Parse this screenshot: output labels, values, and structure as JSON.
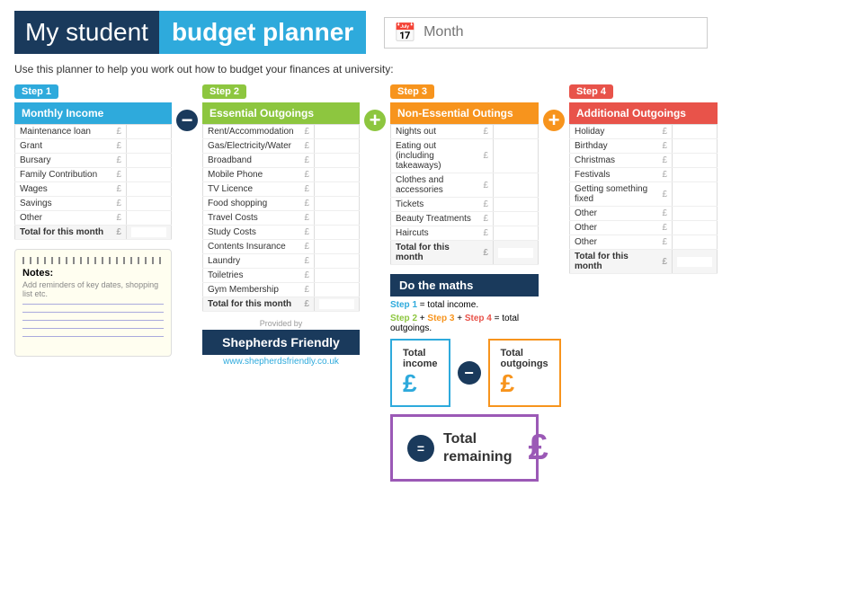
{
  "header": {
    "title_left": "My student",
    "title_right": "budget planner",
    "month_placeholder": "Month"
  },
  "subtitle": "Use this planner to help you work out how to budget your finances at university:",
  "steps": {
    "step1": {
      "label": "Step 1",
      "title": "Monthly Income",
      "rows": [
        {
          "label": "Maintenance loan",
          "currency": "£"
        },
        {
          "label": "Grant",
          "currency": "£"
        },
        {
          "label": "Bursary",
          "currency": "£"
        },
        {
          "label": "Family Contribution",
          "currency": "£"
        },
        {
          "label": "Wages",
          "currency": "£"
        },
        {
          "label": "Savings",
          "currency": "£"
        },
        {
          "label": "Other",
          "currency": "£"
        }
      ],
      "total_label": "Total for this month",
      "total_currency": "£"
    },
    "step2": {
      "label": "Step 2",
      "title": "Essential Outgoings",
      "rows": [
        {
          "label": "Rent/Accommodation",
          "currency": "£"
        },
        {
          "label": "Gas/Electricity/Water",
          "currency": "£"
        },
        {
          "label": "Broadband",
          "currency": "£"
        },
        {
          "label": "Mobile Phone",
          "currency": "£"
        },
        {
          "label": "TV Licence",
          "currency": "£"
        },
        {
          "label": "Food shopping",
          "currency": "£"
        },
        {
          "label": "Travel Costs",
          "currency": "£"
        },
        {
          "label": "Study Costs",
          "currency": "£"
        },
        {
          "label": "Contents Insurance",
          "currency": "£"
        },
        {
          "label": "Laundry",
          "currency": "£"
        },
        {
          "label": "Toiletries",
          "currency": "£"
        },
        {
          "label": "Gym Membership",
          "currency": "£"
        }
      ],
      "total_label": "Total for this month",
      "total_currency": "£"
    },
    "step3": {
      "label": "Step 3",
      "title": "Non-Essential Outings",
      "rows": [
        {
          "label": "Nights out",
          "currency": "£"
        },
        {
          "label": "Eating out (including takeaways)",
          "currency": "£"
        },
        {
          "label": "Clothes and accessories",
          "currency": "£"
        },
        {
          "label": "Tickets",
          "currency": "£"
        },
        {
          "label": "Beauty Treatments",
          "currency": "£"
        },
        {
          "label": "Haircuts",
          "currency": "£"
        }
      ],
      "total_label": "Total for this month",
      "total_currency": "£"
    },
    "step4": {
      "label": "Step 4",
      "title": "Additional Outgoings",
      "rows": [
        {
          "label": "Holiday",
          "currency": "£"
        },
        {
          "label": "Birthday",
          "currency": "£"
        },
        {
          "label": "Christmas",
          "currency": "£"
        },
        {
          "label": "Festivals",
          "currency": "£"
        },
        {
          "label": "Getting something fixed",
          "currency": "£"
        },
        {
          "label": "Other",
          "currency": "£"
        },
        {
          "label": "Other",
          "currency": "£"
        },
        {
          "label": "Other",
          "currency": "£"
        }
      ],
      "total_label": "Total for this month",
      "total_currency": "£"
    }
  },
  "notes": {
    "title": "Notes:",
    "subtitle": "Add reminders of key dates, shopping list etc."
  },
  "provided_by": "Provided by",
  "shepherds": {
    "name": "Shepherds Friendly",
    "url": "www.shepherdsfriendly.co.uk"
  },
  "do_maths": {
    "title": "Do the maths",
    "line1_prefix": "Step 1",
    "line1_text": " = total income.",
    "line2_step2": "Step 2",
    "line2_plus1": " + ",
    "line2_step3": "Step 3",
    "line2_plus2": " + ",
    "line2_step4": "Step 4",
    "line2_text": " = total outgoings.",
    "total_income_label": "Total\nincome",
    "total_income_pound": "£",
    "total_outgoings_label": "Total\noutgoings",
    "total_outgoings_pound": "£",
    "total_remaining_label": "Total\nremaining",
    "total_remaining_pound": "£"
  }
}
